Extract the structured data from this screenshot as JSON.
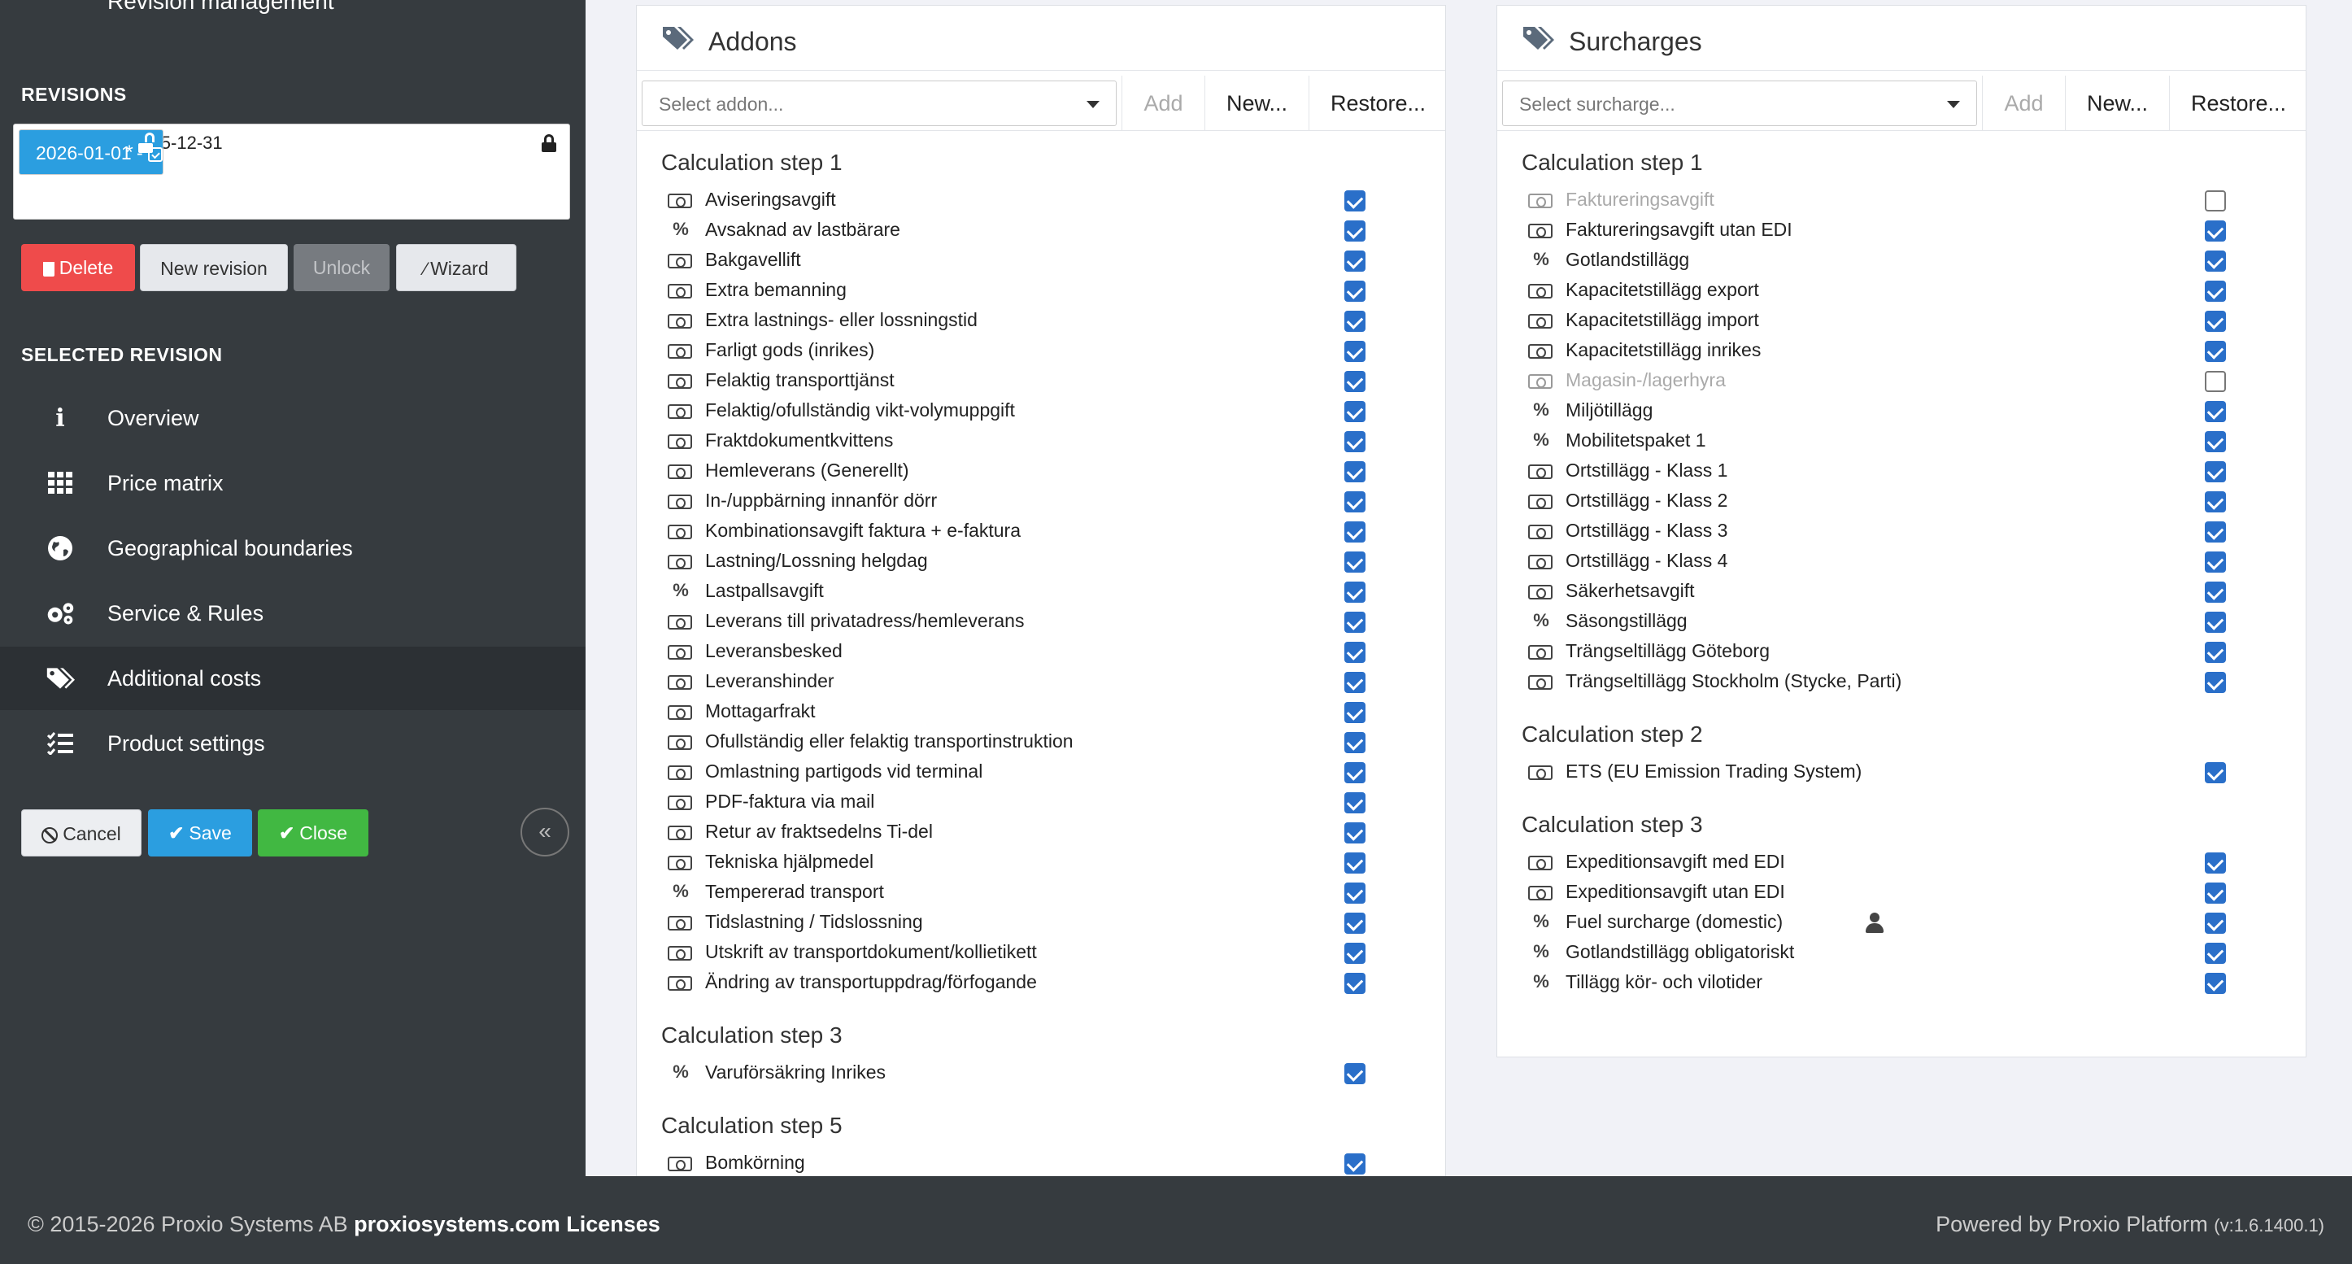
{
  "sidebar": {
    "header_title": "Revision management",
    "revisions_title": "REVISIONS",
    "revisions": [
      {
        "label": "2024-05-01 - 2025-12-31",
        "locked": true
      },
      {
        "label": "2026-01-01 -",
        "selected": true,
        "modified_marker": "*"
      }
    ],
    "buttons": {
      "delete": "Delete",
      "new_revision": "New revision",
      "unlock": "Unlock",
      "wizard": "Wizard"
    },
    "selected_revision_title": "SELECTED REVISION",
    "nav": [
      {
        "label": "Overview",
        "icon": "info-icon"
      },
      {
        "label": "Price matrix",
        "icon": "grid-icon"
      },
      {
        "label": "Geographical boundaries",
        "icon": "globe-icon"
      },
      {
        "label": "Service & Rules",
        "icon": "gears-icon"
      },
      {
        "label": "Additional costs",
        "icon": "tags-icon",
        "active": true
      },
      {
        "label": "Product settings",
        "icon": "list-check-icon"
      }
    ],
    "actions": {
      "cancel": "Cancel",
      "save": "Save",
      "close": "Close"
    },
    "collapse_symbol": "«"
  },
  "addons": {
    "title": "Addons",
    "select_placeholder": "Select addon...",
    "add_label": "Add",
    "new_label": "New...",
    "restore_label": "Restore...",
    "steps": [
      {
        "title": "Calculation step 1",
        "items": [
          {
            "label": "Aviseringsavgift",
            "type": "money",
            "checked": true
          },
          {
            "label": "Avsaknad av lastbärare",
            "type": "percent",
            "checked": true
          },
          {
            "label": "Bakgavellift",
            "type": "money",
            "checked": true
          },
          {
            "label": "Extra bemanning",
            "type": "money",
            "checked": true
          },
          {
            "label": "Extra lastnings- eller lossningstid",
            "type": "money",
            "checked": true
          },
          {
            "label": "Farligt gods (inrikes)",
            "type": "money",
            "checked": true
          },
          {
            "label": "Felaktig transporttjänst",
            "type": "money",
            "checked": true
          },
          {
            "label": "Felaktig/ofullständig vikt-volymuppgift",
            "type": "money",
            "checked": true
          },
          {
            "label": "Fraktdokumentkvittens",
            "type": "money",
            "checked": true
          },
          {
            "label": "Hemleverans (Generellt)",
            "type": "money",
            "checked": true
          },
          {
            "label": "In-/uppbärning innanför dörr",
            "type": "money",
            "checked": true
          },
          {
            "label": "Kombinationsavgift faktura + e-faktura",
            "type": "money",
            "checked": true
          },
          {
            "label": "Lastning/Lossning helgdag",
            "type": "money",
            "checked": true
          },
          {
            "label": "Lastpallsavgift",
            "type": "percent",
            "checked": true
          },
          {
            "label": "Leverans till privatadress/hemleverans",
            "type": "money",
            "checked": true
          },
          {
            "label": "Leveransbesked",
            "type": "money",
            "checked": true
          },
          {
            "label": "Leveranshinder",
            "type": "money",
            "checked": true
          },
          {
            "label": "Mottagarfrakt",
            "type": "money",
            "checked": true
          },
          {
            "label": "Ofullständig eller felaktig transportinstruktion",
            "type": "money",
            "checked": true
          },
          {
            "label": "Omlastning partigods vid terminal",
            "type": "money",
            "checked": true
          },
          {
            "label": "PDF-faktura via mail",
            "type": "money",
            "checked": true
          },
          {
            "label": "Retur av fraktsedelns Ti-del",
            "type": "money",
            "checked": true
          },
          {
            "label": "Tekniska hjälpmedel",
            "type": "money",
            "checked": true
          },
          {
            "label": "Tempererad transport",
            "type": "percent",
            "checked": true
          },
          {
            "label": "Tidslastning / Tidslossning",
            "type": "money",
            "checked": true
          },
          {
            "label": "Utskrift av transportdokument/kollietikett",
            "type": "money",
            "checked": true
          },
          {
            "label": "Ändring av transportuppdrag/förfogande",
            "type": "money",
            "checked": true
          }
        ]
      },
      {
        "title": "Calculation step 3",
        "items": [
          {
            "label": "Varuförsäkring Inrikes",
            "type": "percent",
            "checked": true
          }
        ]
      },
      {
        "title": "Calculation step 5",
        "items": [
          {
            "label": "Bomkörning",
            "type": "money",
            "checked": true
          }
        ]
      }
    ]
  },
  "surcharges": {
    "title": "Surcharges",
    "select_placeholder": "Select surcharge...",
    "add_label": "Add",
    "new_label": "New...",
    "restore_label": "Restore...",
    "steps": [
      {
        "title": "Calculation step 1",
        "items": [
          {
            "label": "Faktureringsavgift",
            "type": "money",
            "checked": false,
            "muted": true
          },
          {
            "label": "Faktureringsavgift utan EDI",
            "type": "money",
            "checked": true
          },
          {
            "label": "Gotlandstillägg",
            "type": "percent",
            "checked": true
          },
          {
            "label": "Kapacitetstillägg export",
            "type": "money",
            "checked": true
          },
          {
            "label": "Kapacitetstillägg import",
            "type": "money",
            "checked": true
          },
          {
            "label": "Kapacitetstillägg inrikes",
            "type": "money",
            "checked": true
          },
          {
            "label": "Magasin-/lagerhyra",
            "type": "money",
            "checked": false,
            "muted": true
          },
          {
            "label": "Miljötillägg",
            "type": "percent",
            "checked": true
          },
          {
            "label": "Mobilitetspaket 1",
            "type": "percent",
            "checked": true
          },
          {
            "label": "Ortstillägg - Klass 1",
            "type": "money",
            "checked": true
          },
          {
            "label": "Ortstillägg - Klass 2",
            "type": "money",
            "checked": true
          },
          {
            "label": "Ortstillägg - Klass 3",
            "type": "money",
            "checked": true
          },
          {
            "label": "Ortstillägg - Klass 4",
            "type": "money",
            "checked": true
          },
          {
            "label": "Säkerhetsavgift",
            "type": "money",
            "checked": true
          },
          {
            "label": "Säsongstillägg",
            "type": "percent",
            "checked": true
          },
          {
            "label": "Trängseltillägg Göteborg",
            "type": "money",
            "checked": true
          },
          {
            "label": "Trängseltillägg Stockholm (Stycke, Parti)",
            "type": "money",
            "checked": true
          }
        ]
      },
      {
        "title": "Calculation step 2",
        "items": [
          {
            "label": "ETS (EU Emission Trading System)",
            "type": "money",
            "checked": true
          }
        ]
      },
      {
        "title": "Calculation step 3",
        "items": [
          {
            "label": "Expeditionsavgift med EDI",
            "type": "money",
            "checked": true
          },
          {
            "label": "Expeditionsavgift utan EDI",
            "type": "money",
            "checked": true
          },
          {
            "label": "Fuel surcharge (domestic)",
            "type": "percent",
            "checked": true,
            "person": true
          },
          {
            "label": "Gotlandstillägg obligatoriskt",
            "type": "percent",
            "checked": true
          },
          {
            "label": "Tillägg kör- och vilotider",
            "type": "percent",
            "checked": true
          }
        ]
      }
    ]
  },
  "footer": {
    "copyright": "© 2015-2026 Proxio Systems AB",
    "site_link": "proxiosystems.com",
    "licenses_link": "Licenses",
    "powered_by": "Powered by Proxio Platform",
    "version": "(v:1.6.1400.1)"
  }
}
